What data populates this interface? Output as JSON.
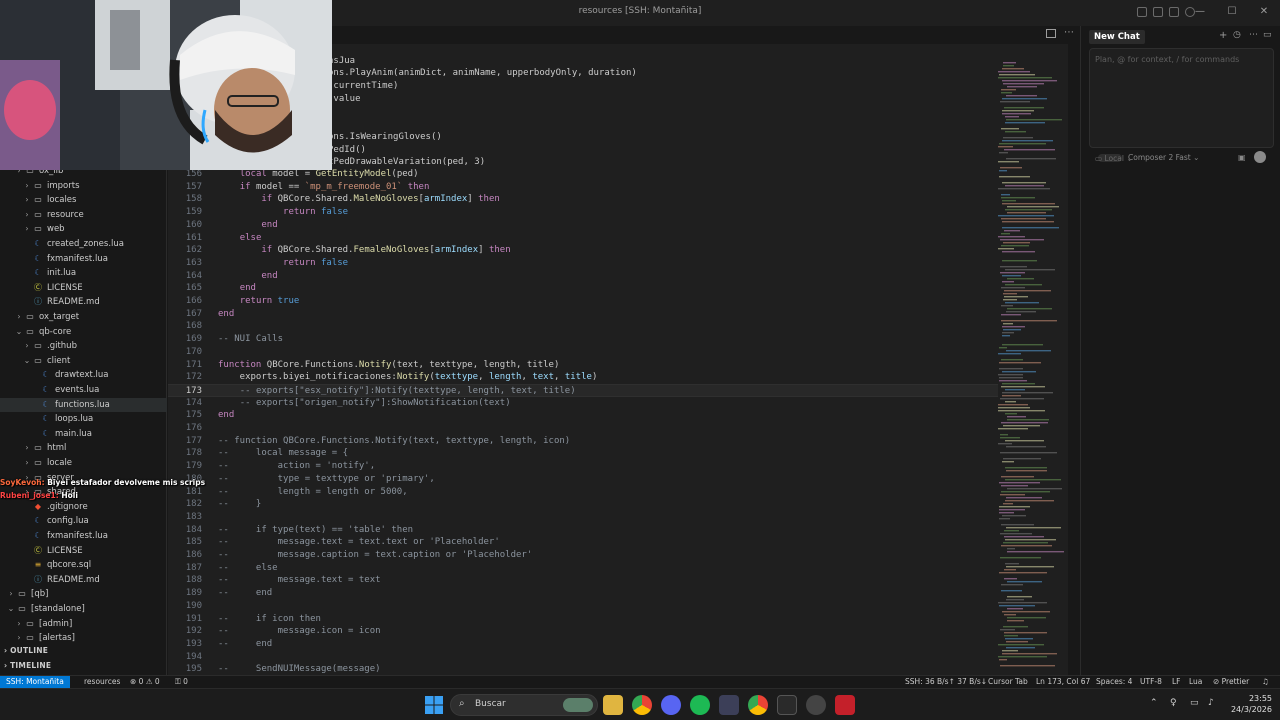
{
  "window": {
    "title": "resources [SSH: Montañita]",
    "controls": [
      "minimize",
      "maximize",
      "close"
    ]
  },
  "explorer": {
    "items": [
      {
        "label": "ox_lib",
        "kind": "folder",
        "depth": 1,
        "chev": "›"
      },
      {
        "label": "imports",
        "kind": "folder",
        "depth": 2,
        "chev": "›"
      },
      {
        "label": "locales",
        "kind": "folder",
        "depth": 2,
        "chev": "›"
      },
      {
        "label": "resource",
        "kind": "folder",
        "depth": 2,
        "chev": "›"
      },
      {
        "label": "web",
        "kind": "folder",
        "depth": 2,
        "chev": "›"
      },
      {
        "label": "created_zones.lua",
        "kind": "lua",
        "depth": 2,
        "chev": ""
      },
      {
        "label": "fxmanifest.lua",
        "kind": "lua",
        "depth": 2,
        "chev": ""
      },
      {
        "label": "init.lua",
        "kind": "lua",
        "depth": 2,
        "chev": ""
      },
      {
        "label": "LICENSE",
        "kind": "lic",
        "depth": 2,
        "chev": ""
      },
      {
        "label": "README.md",
        "kind": "md",
        "depth": 2,
        "chev": ""
      },
      {
        "label": "ox_target",
        "kind": "folder",
        "depth": 1,
        "chev": "›"
      },
      {
        "label": "qb-core",
        "kind": "folder",
        "depth": 1,
        "chev": "⌄"
      },
      {
        "label": ".github",
        "kind": "folder",
        "depth": 2,
        "chev": "›"
      },
      {
        "label": "client",
        "kind": "folder",
        "depth": 2,
        "chev": "⌄"
      },
      {
        "label": "drawtext.lua",
        "kind": "lua",
        "depth": 3,
        "chev": ""
      },
      {
        "label": "events.lua",
        "kind": "lua",
        "depth": 3,
        "chev": ""
      },
      {
        "label": "functions.lua",
        "kind": "lua",
        "depth": 3,
        "chev": "",
        "selected": true
      },
      {
        "label": "loops.lua",
        "kind": "lua",
        "depth": 3,
        "chev": ""
      },
      {
        "label": "main.lua",
        "kind": "lua",
        "depth": 3,
        "chev": ""
      },
      {
        "label": "html",
        "kind": "folder",
        "depth": 2,
        "chev": "›"
      },
      {
        "label": "locale",
        "kind": "folder",
        "depth": 2,
        "chev": "›"
      },
      {
        "label": "server",
        "kind": "folder",
        "depth": 2,
        "chev": "›"
      },
      {
        "label": "shared",
        "kind": "folder",
        "depth": 2,
        "chev": "›"
      },
      {
        "label": ".gitignore",
        "kind": "git",
        "depth": 2,
        "chev": ""
      },
      {
        "label": "config.lua",
        "kind": "lua",
        "depth": 2,
        "chev": ""
      },
      {
        "label": "fxmanifest.lua",
        "kind": "lua",
        "depth": 2,
        "chev": ""
      },
      {
        "label": "LICENSE",
        "kind": "lic",
        "depth": 2,
        "chev": ""
      },
      {
        "label": "qbcore.sql",
        "kind": "sql",
        "depth": 2,
        "chev": ""
      },
      {
        "label": "README.md",
        "kind": "md",
        "depth": 2,
        "chev": ""
      },
      {
        "label": "[qb]",
        "kind": "folder",
        "depth": 0,
        "chev": "›"
      },
      {
        "label": "[standalone]",
        "kind": "folder",
        "depth": 0,
        "chev": "⌄"
      },
      {
        "label": "[admin]",
        "kind": "folder",
        "depth": 1,
        "chev": "›"
      },
      {
        "label": "[alertas]",
        "kind": "folder",
        "depth": 1,
        "chev": "›"
      }
    ],
    "outline_label": "OUTLINE",
    "timeline_label": "TIMELINE"
  },
  "chat_overlay": [
    {
      "user": "SoyKevoh:",
      "message": "Biyei estafador devolveme mis scrips"
    },
    {
      "user": "Rubeni_jose1:",
      "message": "Holi"
    }
  ],
  "editor": {
    "current_line": 173,
    "partial_lines": [
      {
        "row": 1,
        "text": "nsJua"
      },
      {
        "row": 2,
        "text": "ons.PlayAnim(animDict, animName, upperbodyOnly, duration)"
      },
      {
        "row": 3,
        "text": "(currentTime)"
      },
      {
        "row": 4,
        "text": ".value"
      },
      {
        "row": 7,
        "text": "ons.IsWearingGloves()"
      },
      {
        "row": 8,
        "text": "PedId()"
      },
      {
        "row": 9,
        "text": "tPedDrawableVariation(ped, 3)"
      }
    ],
    "lines": [
      {
        "n": 156,
        "html": "    <span class=\"k\">local</span> model = <span class=\"fn\">GetEntityModel</span>(ped)"
      },
      {
        "n": 157,
        "html": "    <span class=\"k\">if</span> model == <span class=\"str\">`mp_m_freemode_01`</span> <span class=\"k\">then</span>"
      },
      {
        "n": 158,
        "html": "        <span class=\"k\">if</span> QBCore.Shared.<span class=\"fn\">MaleNoGloves</span>[<span class=\"var\">armIndex</span>] <span class=\"k\">then</span>"
      },
      {
        "n": 159,
        "html": "            <span class=\"k\">return</span> <span class=\"kw\">false</span>"
      },
      {
        "n": 160,
        "html": "        <span class=\"k\">end</span>"
      },
      {
        "n": 161,
        "html": "    <span class=\"k\">else</span>"
      },
      {
        "n": 162,
        "html": "        <span class=\"k\">if</span> QBCore.Shared.<span class=\"fn\">FemaleNoGloves</span>[<span class=\"var\">armIndex</span>] <span class=\"k\">then</span>"
      },
      {
        "n": 163,
        "html": "            <span class=\"k\">return</span> <span class=\"kw\">false</span>"
      },
      {
        "n": 164,
        "html": "        <span class=\"k\">end</span>"
      },
      {
        "n": 165,
        "html": "    <span class=\"k\">end</span>"
      },
      {
        "n": 166,
        "html": "    <span class=\"k\">return</span> <span class=\"kw\">true</span>"
      },
      {
        "n": 167,
        "html": "<span class=\"k\">end</span>"
      },
      {
        "n": 168,
        "html": ""
      },
      {
        "n": 169,
        "html": "<span class=\"cm\">-- NUI Calls</span>"
      },
      {
        "n": 170,
        "html": ""
      },
      {
        "n": 171,
        "html": "<span class=\"k\">function</span> QBCore.Functions.<span class=\"fn\">Notify</span>(text, texttype, length, title)"
      },
      {
        "n": 172,
        "html": "    exports.biyei_notificaciones:<span class=\"fn\">Notify</span>(<span class=\"var\">texttype</span>, <span class=\"var\">length</span>, <span class=\"var\">text</span>, <span class=\"var\">title</span>)"
      },
      {
        "n": 173,
        "html": "    <span class=\"cm\">-- exports[\"esx_notify\"]:Notify(texttype, length, text, title)</span>"
      },
      {
        "n": 174,
        "html": "    <span class=\"cm\">-- exports[\"origen_notify\"]:ShowNotification(text)</span>"
      },
      {
        "n": 175,
        "html": "<span class=\"k\">end</span>"
      },
      {
        "n": 176,
        "html": ""
      },
      {
        "n": 177,
        "html": "<span class=\"cm\">-- function QBCore.Functions.Notify(text, texttype, length, icon)</span>"
      },
      {
        "n": 178,
        "html": "<span class=\"cm\">--     local message = {</span>"
      },
      {
        "n": 179,
        "html": "<span class=\"cm\">--         action = 'notify',</span>"
      },
      {
        "n": 180,
        "html": "<span class=\"cm\">--         type = texttype or 'primary',</span>"
      },
      {
        "n": 181,
        "html": "<span class=\"cm\">--         length = length or 5000,</span>"
      },
      {
        "n": 182,
        "html": "<span class=\"cm\">--     }</span>"
      },
      {
        "n": 183,
        "html": ""
      },
      {
        "n": 184,
        "html": "<span class=\"cm\">--     if type(text) == 'table' then</span>"
      },
      {
        "n": 185,
        "html": "<span class=\"cm\">--         message.text = text.text or 'Placeholder'</span>"
      },
      {
        "n": 186,
        "html": "<span class=\"cm\">--         message.caption = text.caption or 'Placeholder'</span>"
      },
      {
        "n": 187,
        "html": "<span class=\"cm\">--     else</span>"
      },
      {
        "n": 188,
        "html": "<span class=\"cm\">--         message.text = text</span>"
      },
      {
        "n": 189,
        "html": "<span class=\"cm\">--     end</span>"
      },
      {
        "n": 190,
        "html": ""
      },
      {
        "n": 191,
        "html": "<span class=\"cm\">--     if icon then</span>"
      },
      {
        "n": 192,
        "html": "<span class=\"cm\">--         message.icon = icon</span>"
      },
      {
        "n": 193,
        "html": "<span class=\"cm\">--     end</span>"
      },
      {
        "n": 194,
        "html": ""
      },
      {
        "n": 195,
        "html": "<span class=\"cm\">--     SendNUIMessage(message)</span>"
      }
    ]
  },
  "chat_panel": {
    "tab_label": "New Chat",
    "placeholder": "Plan, @ for context, / for commands",
    "model_label": "Composer 2 Fast",
    "mode_label": "Local"
  },
  "statusbar": {
    "remote": "SSH: Montañita",
    "folder": "resources",
    "problems": "⊗ 0 ⚠ 0",
    "ports": "⚿ 0",
    "ssh_rate": "SSH: 36 B/s↑ 37 B/s↓",
    "cursor_tab": "Cursor Tab",
    "position": "Ln 173, Col 67",
    "spaces": "Spaces: 4",
    "encoding": "UTF-8",
    "eol": "LF",
    "language": "Lua",
    "formatter": "⊘ Prettier"
  },
  "taskbar": {
    "search_label": "Buscar",
    "time": "23:55",
    "date": "24/3/2026"
  },
  "colors": {
    "accent": "#0078d4",
    "editor_bg": "#1f1f1f",
    "sidebar_bg": "#181818"
  }
}
